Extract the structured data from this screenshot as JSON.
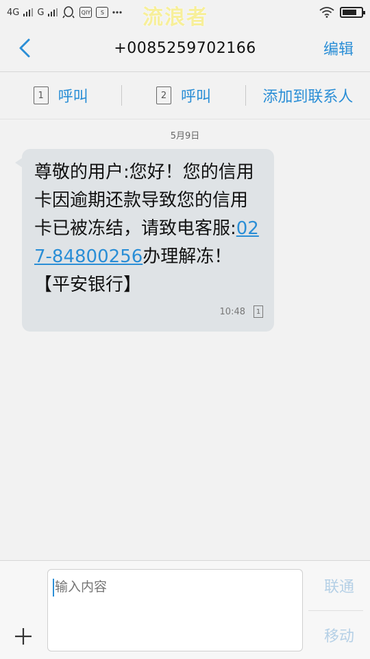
{
  "status": {
    "network1": "4G",
    "network2": "G",
    "watermark": "流浪者"
  },
  "header": {
    "title": "+0085259702166",
    "edit_label": "编辑"
  },
  "actions": {
    "call1_sim": "1",
    "call1_label": "呼叫",
    "call2_sim": "2",
    "call2_label": "呼叫",
    "add_contact_label": "添加到联系人"
  },
  "thread": {
    "date": "5月9日",
    "message": {
      "text_before": "尊敬的用户:您好！您的信用卡因逾期还款导致您的信用卡已被冻结，请致电客服:",
      "phone": "027-84800256",
      "text_after": "办理解冻！【平安银行】",
      "time": "10:48",
      "sim": "1"
    }
  },
  "compose": {
    "placeholder": "输入内容",
    "send_unicom": "联通",
    "send_mobile": "移动"
  },
  "colors": {
    "accent": "#2a8ed6",
    "bubble": "#dfe3e6",
    "background": "#f2f2f2"
  }
}
